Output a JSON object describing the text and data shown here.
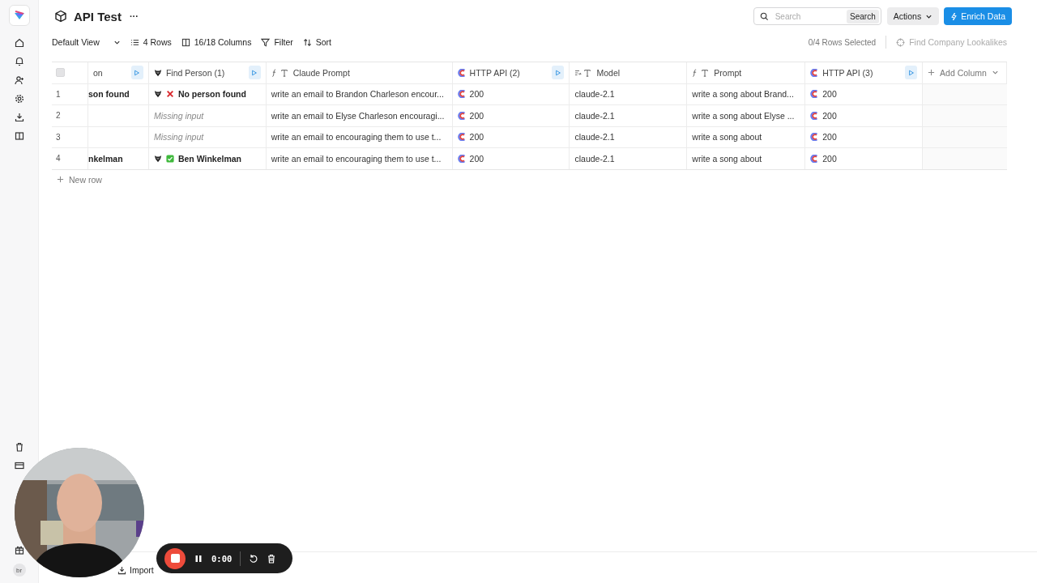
{
  "header": {
    "title": "API Test",
    "more": "···",
    "search": {
      "placeholder": "Search",
      "button": "Search"
    },
    "actions": "Actions",
    "enrich": "Enrich Data"
  },
  "toolbar": {
    "view": "Default View",
    "rows": "4 Rows",
    "columns": "16/18 Columns",
    "filter": "Filter",
    "sort": "Sort",
    "selected": "0/4 Rows Selected",
    "lookalikes": {
      "label": "Find Company Lookalikes",
      "disabled": true
    }
  },
  "table": {
    "select_all": {
      "checked": false
    },
    "columns": [
      {
        "kind": "partial",
        "label": "on",
        "runnable": true
      },
      {
        "kind": "enrichment",
        "label": "Find Person (1)",
        "runnable": true
      },
      {
        "kind": "formula",
        "label": "Claude Prompt",
        "runnable": false
      },
      {
        "kind": "http",
        "label": "HTTP API (2)",
        "runnable": true
      },
      {
        "kind": "input",
        "label": "Model",
        "runnable": false
      },
      {
        "kind": "formula",
        "label": "Prompt",
        "runnable": false
      },
      {
        "kind": "http",
        "label": "HTTP API (3)",
        "runnable": true
      }
    ],
    "add_column": "Add Column",
    "rows": [
      {
        "number": "1",
        "cells": [
          {
            "kind": "text",
            "bold": true,
            "text": "son found"
          },
          {
            "kind": "result",
            "found": false,
            "text": "No person found"
          },
          {
            "kind": "text",
            "text": "write an email to Brandon Charleson encour..."
          },
          {
            "kind": "http",
            "text": "200"
          },
          {
            "kind": "text",
            "text": "claude-2.1"
          },
          {
            "kind": "text",
            "text": "write a song about Brand..."
          },
          {
            "kind": "http",
            "text": "200"
          }
        ]
      },
      {
        "number": "2",
        "cells": [
          {
            "kind": "blank"
          },
          {
            "kind": "missing",
            "text": "Missing input"
          },
          {
            "kind": "text",
            "text": "write an email to Elyse Charleson encouragi..."
          },
          {
            "kind": "http",
            "text": "200"
          },
          {
            "kind": "text",
            "text": "claude-2.1"
          },
          {
            "kind": "text",
            "text": "write a song about Elyse ..."
          },
          {
            "kind": "http",
            "text": "200"
          }
        ]
      },
      {
        "number": "3",
        "cells": [
          {
            "kind": "blank"
          },
          {
            "kind": "missing",
            "text": "Missing input"
          },
          {
            "kind": "text",
            "text": "write an email to encouraging them to use t..."
          },
          {
            "kind": "http",
            "text": "200"
          },
          {
            "kind": "text",
            "text": "claude-2.1"
          },
          {
            "kind": "text",
            "text": "write a song about"
          },
          {
            "kind": "http",
            "text": "200"
          }
        ]
      },
      {
        "number": "4",
        "cells": [
          {
            "kind": "text",
            "bold": true,
            "text": "nkelman"
          },
          {
            "kind": "result",
            "found": true,
            "text": "Ben Winkelman"
          },
          {
            "kind": "text",
            "text": "write an email to encouraging them to use t..."
          },
          {
            "kind": "http",
            "text": "200"
          },
          {
            "kind": "text",
            "text": "claude-2.1"
          },
          {
            "kind": "text",
            "text": "write a song about"
          },
          {
            "kind": "http",
            "text": "200"
          }
        ]
      }
    ],
    "new_row": "New row"
  },
  "sidebar": {
    "avatar": "br"
  },
  "footer": {
    "import": "Import"
  },
  "recorder": {
    "time": "0:00",
    "recording": true
  }
}
